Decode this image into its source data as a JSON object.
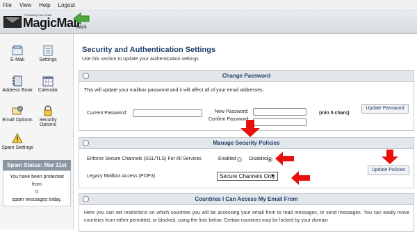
{
  "menu": [
    "File",
    "View",
    "Help",
    "Logout"
  ],
  "logo": {
    "tagline": "\"Protecting Your Email\"",
    "text": "MagicMail",
    "tm": "™"
  },
  "toolbar": {
    "back_label": "Back"
  },
  "sidebar": {
    "items": [
      {
        "label": "E-Mail"
      },
      {
        "label": "Settings"
      },
      {
        "label": "Address Book"
      },
      {
        "label": "Calendar"
      },
      {
        "label": "Email Options"
      },
      {
        "label": "Security Options"
      },
      {
        "label": "Spam Settings"
      }
    ],
    "spam": {
      "title": "Spam Status: Mar 31st",
      "line1": "You have been protected from",
      "count": "0",
      "line2": "spam messages today."
    }
  },
  "page": {
    "title": "Security and Authentication Settings",
    "subtitle": "Use this section to update your authentication settings"
  },
  "change_password": {
    "header": "Change Password",
    "description": "This will update your mailbox password and it will affect all of your email addresses.",
    "current_label": "Current Password:",
    "new_label": "New Password:",
    "confirm_label": "Confirm Password:",
    "hint": "(min 5 chars)",
    "button": "Update Password"
  },
  "security_policies": {
    "header": "Manage Security Policies",
    "enforce_label": "Enforce Secure Channels (SSL/TLS) For All Services",
    "enabled_label": "Enabled",
    "disabled_label": "Disabled",
    "legacy_label": "Legacy Mailbox Access (POP3)",
    "legacy_value": "Secure Channels Only",
    "button": "Update Policies"
  },
  "countries": {
    "header": "Countries I Can Access My Email From",
    "text": "Here you can set restrictions on which countries you will be accessing your email from to read messages, or send messages. You can easily move countries from either permitted, or blocked, using the lists below. Certain countries may be locked by your domain"
  },
  "colors": {
    "accent": "#1f3f6b",
    "arrow": "#e8100c",
    "back_green": "#4fa83d"
  }
}
